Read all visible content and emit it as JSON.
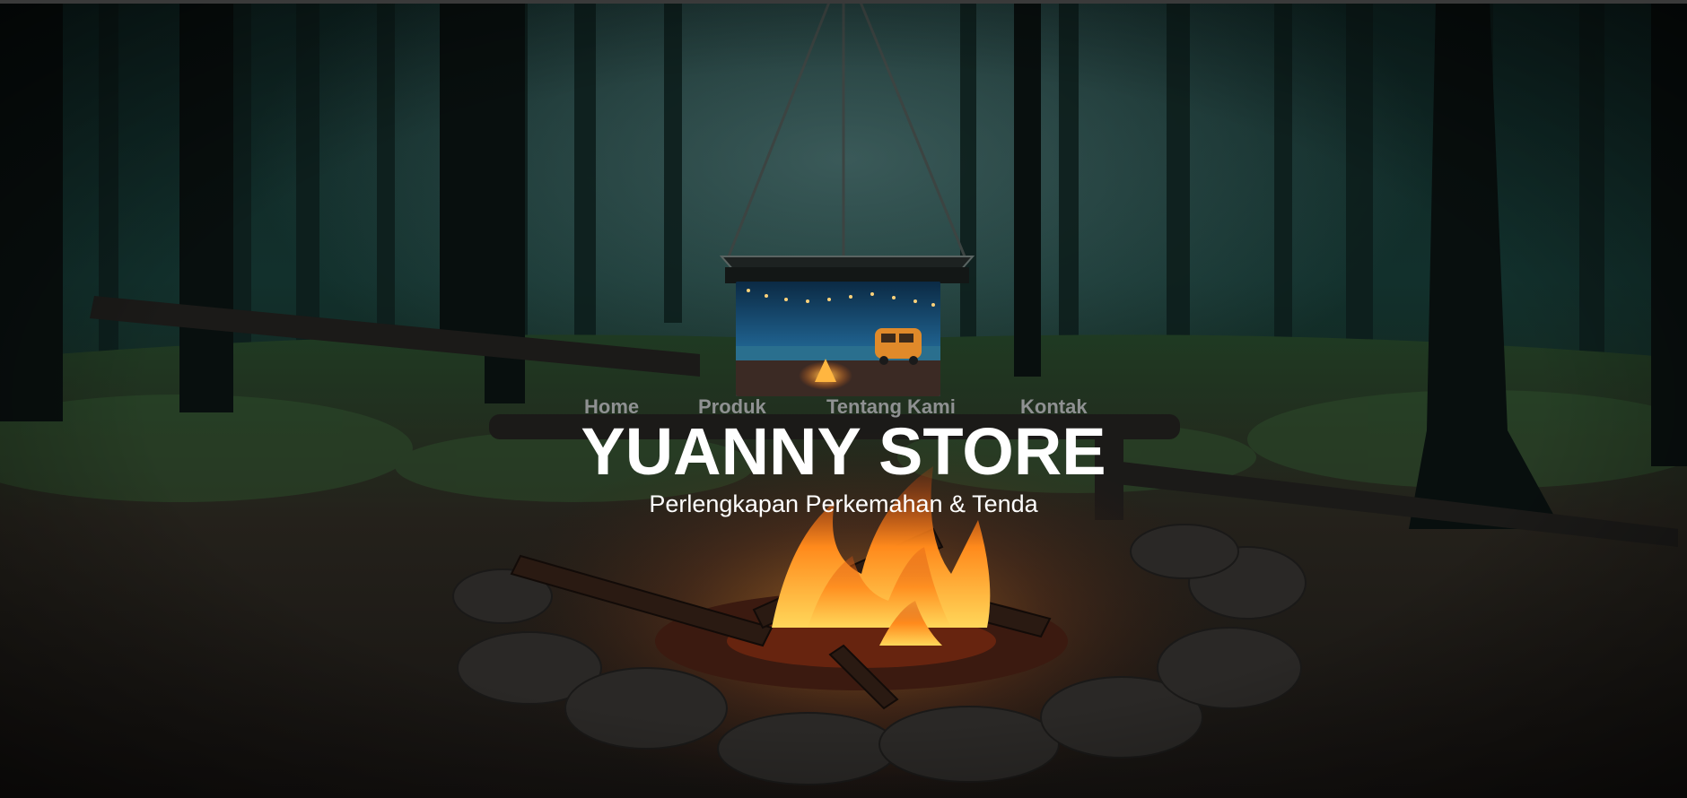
{
  "nav": {
    "items": [
      {
        "label": "Home"
      },
      {
        "label": "Produk"
      },
      {
        "label": "Tentang Kami"
      },
      {
        "label": "Kontak"
      }
    ]
  },
  "hero": {
    "title": "YUANNY STORE",
    "subtitle": "Perlengkapan Perkemahan & Tenda"
  },
  "colors": {
    "nav_text": "#8f9192",
    "title_text": "#ffffff",
    "subtitle_text": "#ffffff",
    "forest_dark": "#0b1513"
  },
  "icons": {
    "hero_image": "forest-campfire-photo",
    "banner_image": "beach-campfire-van-photo"
  }
}
